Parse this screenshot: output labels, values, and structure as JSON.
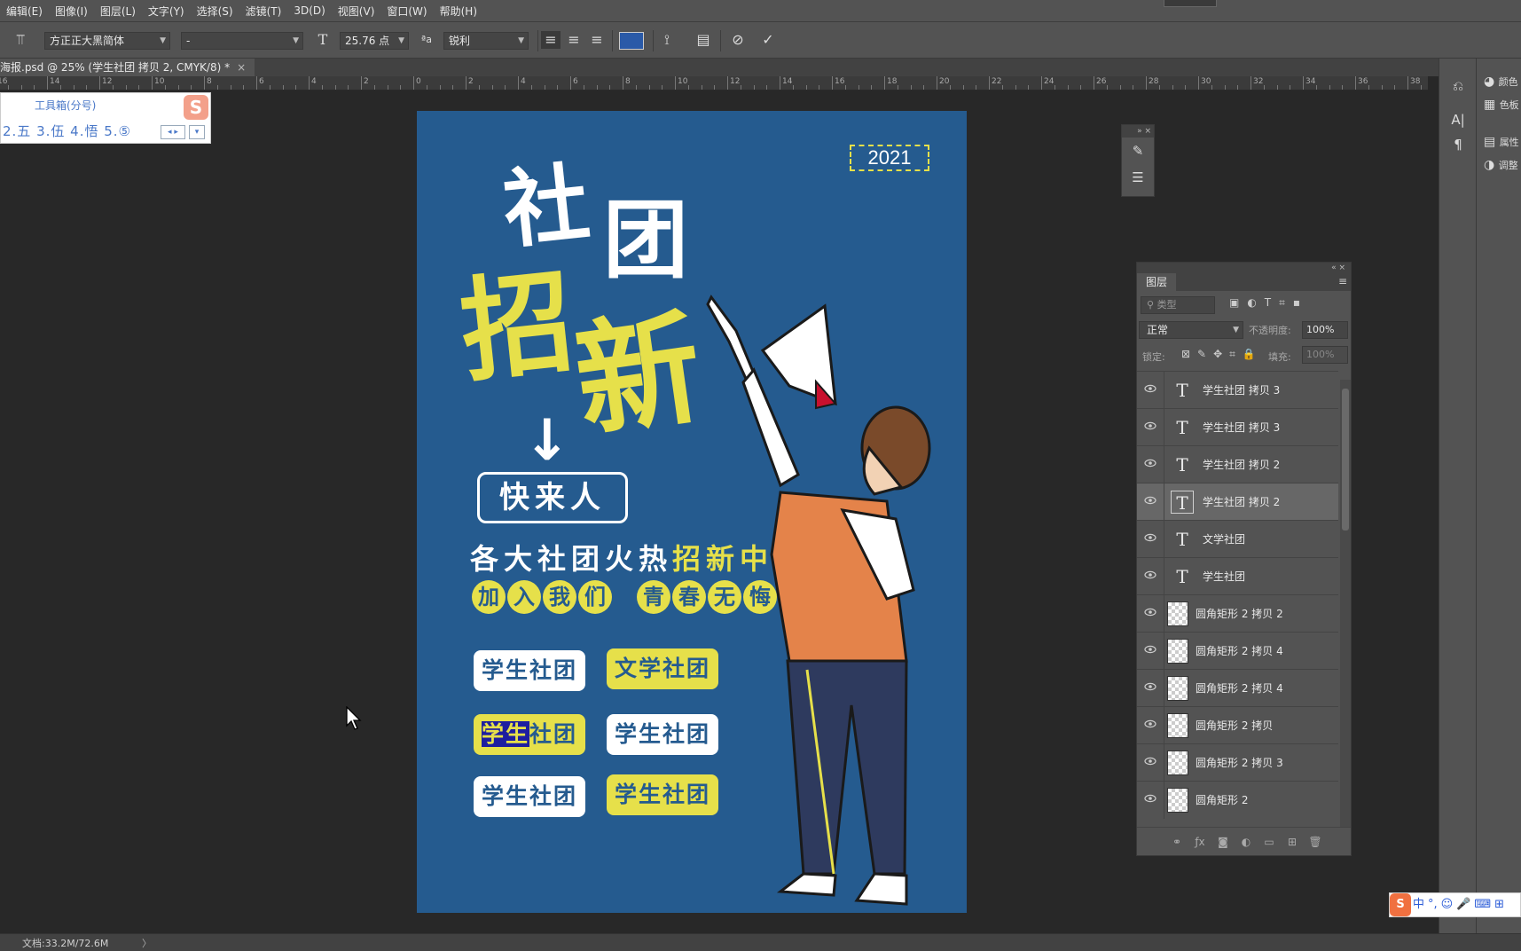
{
  "menubar": {
    "items": [
      "编辑(E)",
      "图像(I)",
      "图层(L)",
      "文字(Y)",
      "选择(S)",
      "滤镜(T)",
      "3D(D)",
      "视图(V)",
      "窗口(W)",
      "帮助(H)"
    ]
  },
  "options": {
    "font_family": "方正正大黑简体",
    "font_style": "-",
    "font_size": "25.76 点",
    "aa_label": "ªa",
    "antialias": "锐利",
    "text_color": "#2a5aa8"
  },
  "document": {
    "tab_title": "海报.psd @ 25% (学生社团 拷贝 2, CMYK/8) *",
    "close": "×"
  },
  "ruler": {
    "labels": [
      "16",
      "14",
      "12",
      "10",
      "8",
      "6",
      "4",
      "2",
      "0",
      "2",
      "4",
      "6",
      "8",
      "10",
      "12",
      "14",
      "16",
      "18",
      "20",
      "22",
      "24",
      "26",
      "28",
      "30",
      "32",
      "34",
      "36",
      "38"
    ]
  },
  "ime": {
    "title": "工具箱(分号)",
    "candidates": "2.五  3.伍  4.悟  5.⑤",
    "logo": "S"
  },
  "poster": {
    "year": "2021",
    "title_1a": "社",
    "title_1b": "团",
    "title_2a": "招",
    "title_2b": "新",
    "arrow": "↓",
    "cta": "快来人",
    "line1_white": "各大社团火热",
    "line1_yellow": "招新中",
    "line2_left": [
      "加",
      "入",
      "我",
      "们"
    ],
    "line2_right": [
      "青",
      "春",
      "无",
      "悔"
    ],
    "tags": {
      "t1": "学生社团",
      "t2": "文学社团",
      "t3_selected": "学生",
      "t3_rest": "社团",
      "t4": "学生社团",
      "t5": "学生社团",
      "t6": "学生社团"
    },
    "colors": {
      "background": "#255b8f",
      "accent_yellow": "#e6e04a",
      "white": "#ffffff"
    }
  },
  "layers_panel": {
    "tab": "图层",
    "filter_placeholder": "类型",
    "blend_mode": "正常",
    "opacity_label": "不透明度:",
    "opacity_value": "100%",
    "lock_label": "锁定:",
    "fill_label": "填充:",
    "fill_value": "100%",
    "layers": [
      {
        "name": "学生社团 拷贝 3",
        "kind": "text",
        "selected": false
      },
      {
        "name": "学生社团 拷贝 3",
        "kind": "text",
        "selected": false
      },
      {
        "name": "学生社团 拷贝 2",
        "kind": "text",
        "selected": false
      },
      {
        "name": "学生社团 拷贝 2",
        "kind": "text",
        "selected": true
      },
      {
        "name": "文学社团",
        "kind": "text",
        "selected": false
      },
      {
        "name": "学生社团",
        "kind": "text",
        "selected": false
      },
      {
        "name": "圆角矩形 2 拷贝 2",
        "kind": "shape",
        "selected": false
      },
      {
        "name": "圆角矩形 2 拷贝 4",
        "kind": "shape",
        "selected": false
      },
      {
        "name": "圆角矩形 2 拷贝 4",
        "kind": "shape",
        "selected": false
      },
      {
        "name": "圆角矩形 2 拷贝",
        "kind": "shape",
        "selected": false
      },
      {
        "name": "圆角矩形 2 拷贝 3",
        "kind": "shape",
        "selected": false
      },
      {
        "name": "圆角矩形 2",
        "kind": "shape",
        "selected": false
      }
    ],
    "text_icon": "T"
  },
  "right_dock": {
    "items": [
      "颜色",
      "色板",
      "属性",
      "调整"
    ]
  },
  "status": {
    "doc_size": "文档:33.2M/72.6M",
    "arrow": "〉"
  },
  "tray": {
    "logo": "S",
    "lang": "中"
  }
}
